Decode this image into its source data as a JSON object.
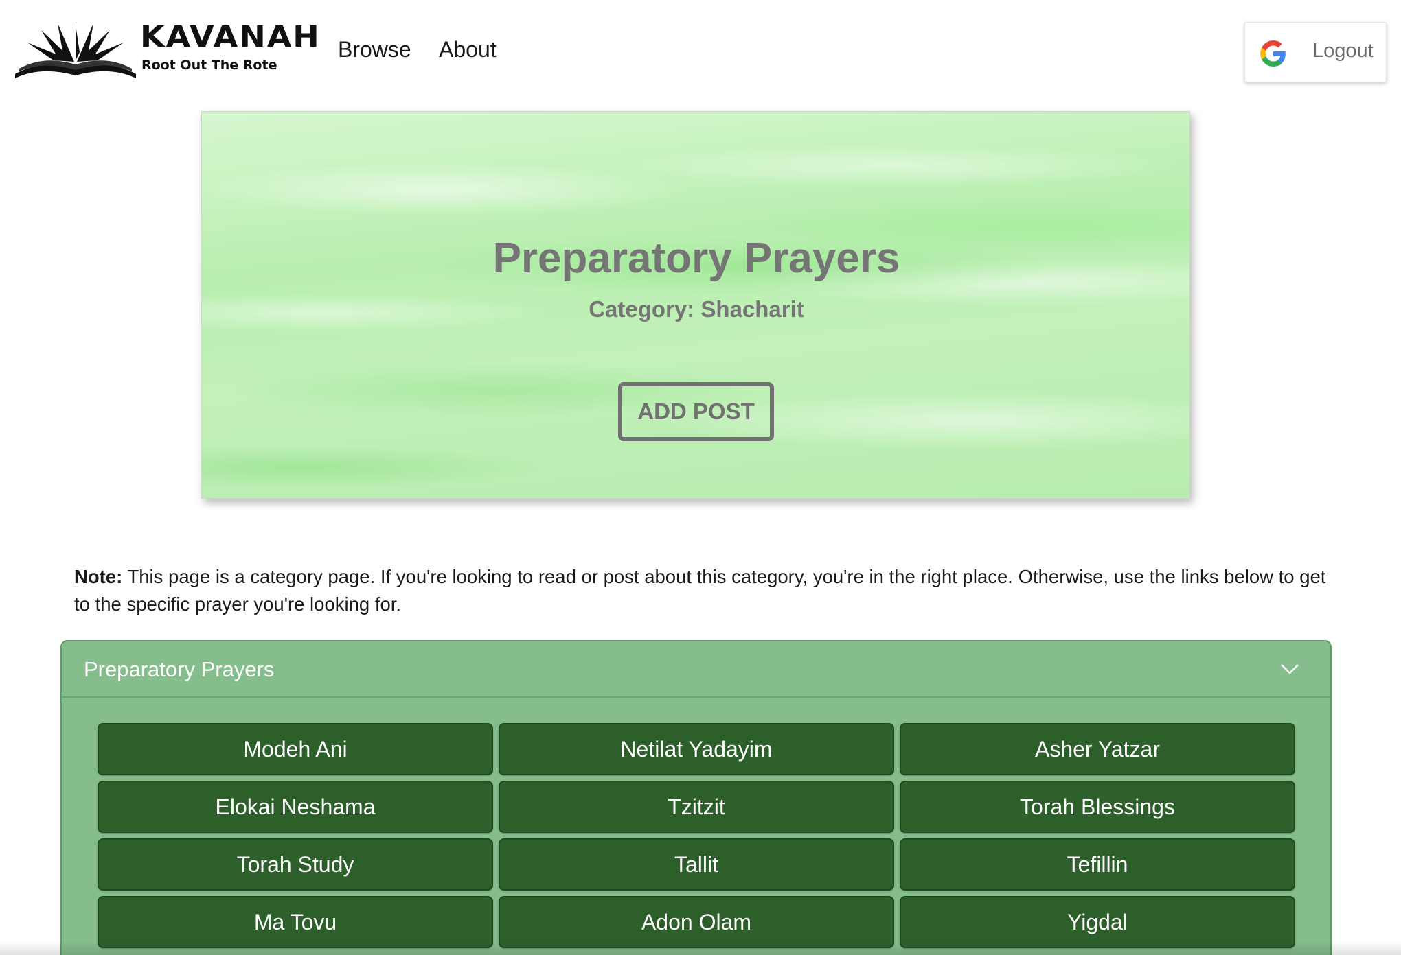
{
  "navbar": {
    "brand_name": "KAVANAH",
    "brand_tagline": "Root Out The Rote",
    "links": [
      "Browse",
      "About"
    ],
    "logout_label": "Logout"
  },
  "hero": {
    "title": "Preparatory Prayers",
    "subtitle": "Category: Shacharit",
    "add_post_label": "ADD POST"
  },
  "note": {
    "label": "Note:",
    "text": "This page is a category page. If you're looking to read or post about this category, you're in the right place. Otherwise, use the links below to get to the specific prayer you're looking for."
  },
  "accordion": {
    "title": "Preparatory Prayers",
    "expanded": true,
    "prayers": [
      "Modeh Ani",
      "Netilat Yadayim",
      "Asher Yatzar",
      "Elokai Neshama",
      "Tzitzit",
      "Torah Blessings",
      "Torah Study",
      "Tallit",
      "Tefillin",
      "Ma Tovu",
      "Adon Olam",
      "Yigdal"
    ]
  },
  "colors": {
    "accordion_bg": "#85bd8c",
    "prayer_button_bg": "#2c5f2a",
    "hero_text": "#757575"
  },
  "icons": {
    "logo": "open-book-icon",
    "login_provider": "google-icon",
    "accordion_toggle": "chevron-down-icon"
  }
}
